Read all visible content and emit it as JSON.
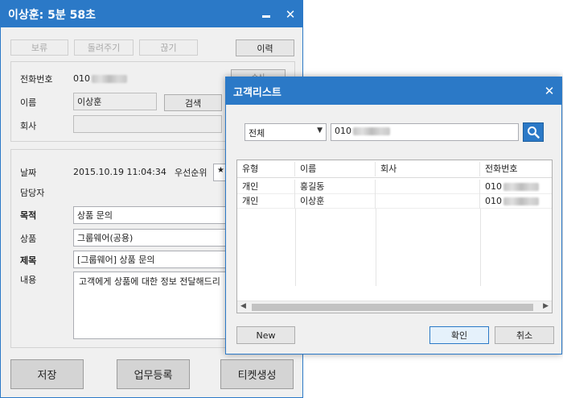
{
  "main_window": {
    "title": "이상훈: 5분 58초",
    "toolbar": {
      "hold": "보류",
      "transfer": "돌려주기",
      "hangup": "끊기",
      "history": "이력"
    },
    "caller": {
      "phone_label": "전화번호",
      "phone_value": "010",
      "name_label": "이름",
      "name_value": "이상훈",
      "search_btn": "검색",
      "company_label": "회사",
      "company_value": "",
      "partial_btn": "수신"
    },
    "ticket": {
      "date_label": "날짜",
      "date_value": "2015.10.19 11:04:34",
      "priority_label": "우선순위",
      "priority_value": "★★",
      "assignee_label": "담당자",
      "purpose_label": "목적",
      "purpose_value": "상품 문의",
      "product_label": "상품",
      "product_value": "그룹웨어(공용)",
      "subject_label": "제목",
      "subject_value": "[그룹웨어] 상품 문의",
      "content_label": "내용",
      "content_value": "고객에게 상품에 대한 정보 전달해드리"
    },
    "footer": {
      "save": "저장",
      "task": "업무등록",
      "ticket": "티켓생성"
    }
  },
  "dialog": {
    "title": "고객리스트",
    "filter": {
      "selected": "전체",
      "search_value": "010"
    },
    "columns": [
      "유형",
      "이름",
      "회사",
      "전화번호"
    ],
    "rows": [
      {
        "type": "개인",
        "name": "홍길동",
        "company": "",
        "phone": "010"
      },
      {
        "type": "개인",
        "name": "이상훈",
        "company": "",
        "phone": "010"
      }
    ],
    "new_btn": "New",
    "ok_btn": "확인",
    "cancel_btn": "취소"
  },
  "colors": {
    "accent": "#2b79c7",
    "window_bg": "#f0f0f0"
  }
}
